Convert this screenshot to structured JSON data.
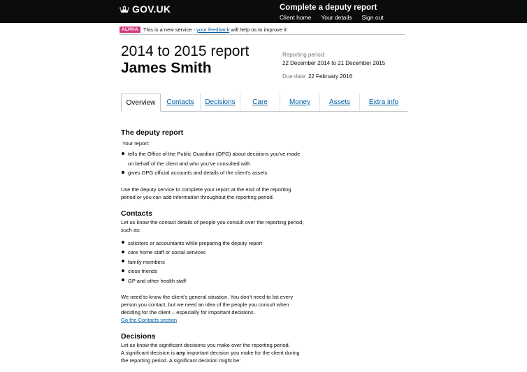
{
  "header": {
    "brand": "GOV.UK",
    "service_name": "Complete a deputy report",
    "nav": [
      "Client home",
      "Your details",
      "Sign out"
    ]
  },
  "phase_banner": {
    "tag": "ALPHA",
    "text_before": "This is a new service -",
    "link": "your feedback",
    "text_after": "will help us to improve it"
  },
  "report": {
    "title_line1": "2014 to 2015 report",
    "title_line2": "James Smith",
    "period_label": "Reporting period:",
    "period_value": "22 December 2014 to 21 December 2015",
    "due_label": "Due date:",
    "due_value": "22 February 2016"
  },
  "tabs": [
    "Overview",
    "Contacts",
    "Decisions",
    "Care",
    "Money",
    "Assets",
    "Extra info"
  ],
  "content": {
    "deputy_report": {
      "heading": "The deputy report",
      "intro": "Your report:",
      "bullets": [
        "tells the Office of the Public Guardian (OPG) about decisions you’ve made on behalf of the client and who you’ve consulted with",
        "gives OPG official accounts and details of the client’s assets"
      ],
      "paragraph": "Use the deputy service to complete your report at the end of the reporting period or you can add information throughout the reporting period."
    },
    "contacts": {
      "heading": "Contacts",
      "intro": "Let us know the contact details of people you consult over the reporting period, such as:",
      "bullets": [
        "solicitors or accountants while preparing the deputy report",
        "care home staff or social services",
        "family members",
        "close friends",
        "GP and other health staff"
      ],
      "paragraph": "We need to know the client’s general situation. You don’t need to list every person you contact, but we need an idea of the people you consult when deciding for the client – especially for important decisions.",
      "link": "Go the Contacts section"
    },
    "decisions": {
      "heading": "Decisions",
      "line1": "Let us know the significant decisions you make over the reporting period.",
      "line2_before": "A significant decision is",
      "line2_bold": "any",
      "line2_after": "important decision you make for the client during the reporting period. A significant decision might be:"
    }
  }
}
